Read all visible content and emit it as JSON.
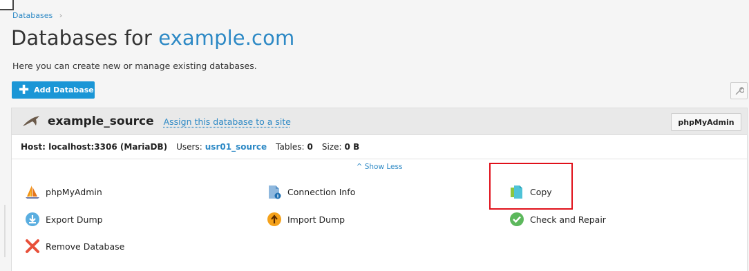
{
  "breadcrumb": {
    "item": "Databases",
    "separator": "›"
  },
  "header": {
    "title_prefix": "Databases for",
    "title_domain": "example.com",
    "subtitle": "Here you can create new or manage existing databases."
  },
  "toolbar": {
    "add_label": "Add Database",
    "tools_icon": "wrench-icon"
  },
  "database": {
    "name": "example_source",
    "assign_link": "Assign this database to a site",
    "phpmyadmin_button": "phpMyAdmin",
    "host_label": "Host: localhost:3306 (MariaDB)",
    "users_label": "Users:",
    "users_value": "usr01_source",
    "tables_label": "Tables:",
    "tables_value": "0",
    "size_label": "Size:",
    "size_value": "0 B",
    "show_less": "^ Show Less"
  },
  "actions": {
    "phpmyadmin": "phpMyAdmin",
    "connection_info": "Connection Info",
    "copy": "Copy",
    "export_dump": "Export Dump",
    "import_dump": "Import Dump",
    "check_repair": "Check and Repair",
    "remove_database": "Remove Database"
  },
  "colors": {
    "accent": "#1a96d6",
    "link": "#2d89c5",
    "highlight": "#e0101a"
  }
}
